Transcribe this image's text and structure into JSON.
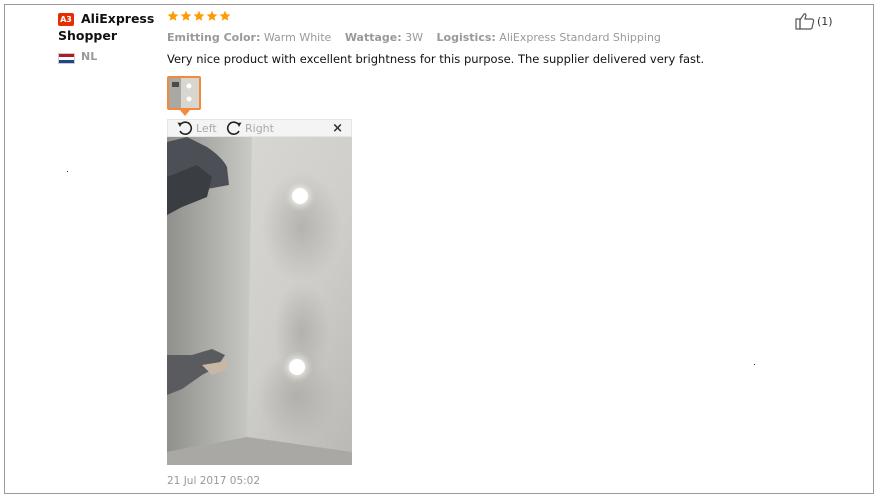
{
  "review": {
    "avatar_text": "A3",
    "reviewer_name": "AliExpress Shopper",
    "country": "NL",
    "rating": 5,
    "attributes": [
      {
        "label": "Emitting Color:",
        "value": "Warm White"
      },
      {
        "label": "Wattage:",
        "value": "3W"
      },
      {
        "label": "Logistics:",
        "value": "AliExpress Standard Shipping"
      }
    ],
    "text": "Very nice product with excellent brightness for this purpose. The supplier delivered very fast.",
    "helpful_count": "(1)",
    "date": "21 Jul 2017 05:02"
  },
  "viewer": {
    "rotate_left_label": "Left",
    "rotate_right_label": "Right",
    "close_label": "×"
  },
  "colors": {
    "accent": "#f08a3c",
    "star": "#ff9a00",
    "avatar_bg": "#e62e04",
    "flag": [
      "#ae1c28",
      "#ffffff",
      "#21468b"
    ]
  }
}
